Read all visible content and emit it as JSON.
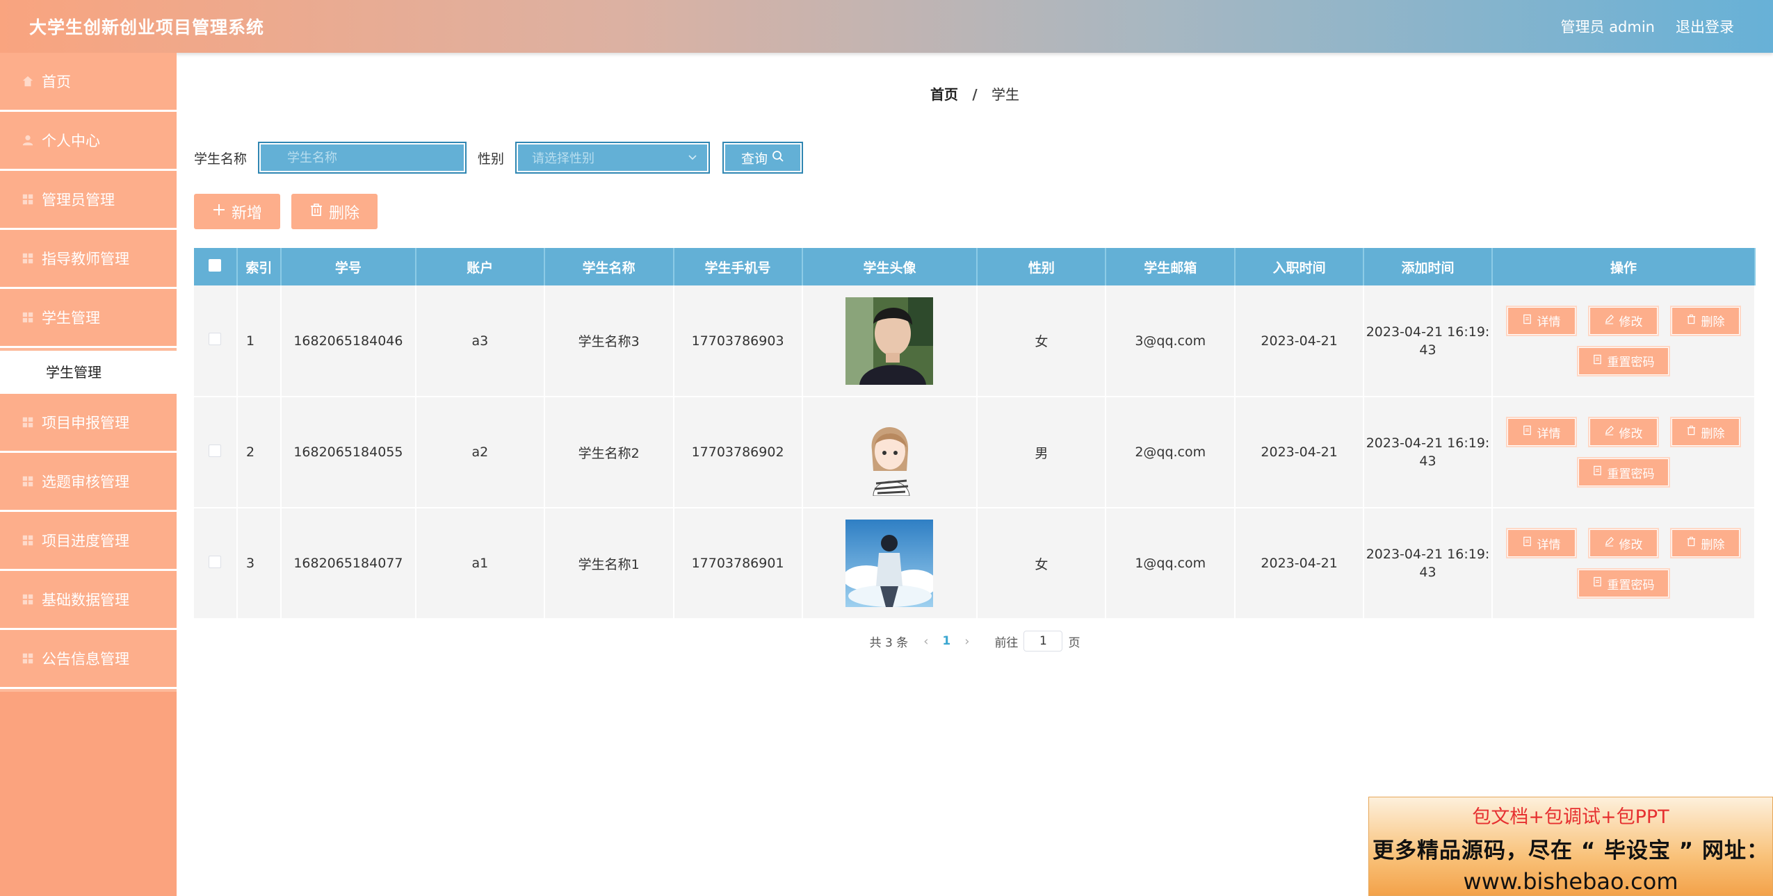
{
  "header": {
    "app_title": "大学生创新创业项目管理系统",
    "user": "管理员 admin",
    "logout": "退出登录"
  },
  "sidebar": {
    "items": [
      {
        "label": "首页",
        "icon": "home-icon"
      },
      {
        "label": "个人中心",
        "icon": "user-icon"
      },
      {
        "label": "管理员管理",
        "icon": "grid-icon"
      },
      {
        "label": "指导教师管理",
        "icon": "grid-icon"
      },
      {
        "label": "学生管理",
        "icon": "grid-icon"
      },
      {
        "label": "项目申报管理",
        "icon": "grid-icon"
      },
      {
        "label": "选题审核管理",
        "icon": "grid-icon"
      },
      {
        "label": "项目进度管理",
        "icon": "grid-icon"
      },
      {
        "label": "基础数据管理",
        "icon": "grid-icon"
      },
      {
        "label": "公告信息管理",
        "icon": "grid-icon"
      }
    ],
    "active_sub": "学生管理"
  },
  "breadcrumb": {
    "home": "首页",
    "sep": "/",
    "current": "学生"
  },
  "search": {
    "name_label": "学生名称",
    "name_placeholder": "学生名称",
    "gender_label": "性别",
    "gender_placeholder": "请选择性别",
    "query_label": "查询"
  },
  "actions": {
    "add": "新增",
    "delete": "删除"
  },
  "table": {
    "headers": [
      "索引",
      "学号",
      "账户",
      "学生名称",
      "学生手机号",
      "学生头像",
      "性别",
      "学生邮箱",
      "入职时间",
      "添加时间",
      "操作"
    ],
    "rows": [
      {
        "index": "1",
        "student_no": "1682065184046",
        "account": "a3",
        "name": "学生名称3",
        "phone": "17703786903",
        "avatar": "photo-man",
        "gender": "女",
        "email": "3@qq.com",
        "join_date": "2023-04-21",
        "added_line1": "2023-04-21 16:19:",
        "added_line2": "43"
      },
      {
        "index": "2",
        "student_no": "1682065184055",
        "account": "a2",
        "name": "学生名称2",
        "phone": "17703786902",
        "avatar": "illustration-girl",
        "gender": "男",
        "email": "2@qq.com",
        "join_date": "2023-04-21",
        "added_line1": "2023-04-21 16:19:",
        "added_line2": "43"
      },
      {
        "index": "3",
        "student_no": "1682065184077",
        "account": "a1",
        "name": "学生名称1",
        "phone": "17703786901",
        "avatar": "illustration-boy-sky",
        "gender": "女",
        "email": "1@qq.com",
        "join_date": "2023-04-21",
        "added_line1": "2023-04-21 16:19:",
        "added_line2": "43"
      }
    ],
    "ops": {
      "detail": "详情",
      "edit": "修改",
      "delete": "删除",
      "reset": "重置密码"
    }
  },
  "pagination": {
    "total": "共 3 条",
    "current": "1",
    "goto": "前往",
    "page_value": "1",
    "page_unit": "页"
  },
  "ad": {
    "line1": "包文档+包调试+包PPT",
    "line2": "更多精品源码，尽在 “ 毕设宝 ” 网址：",
    "line3": "www.bishebao.com"
  },
  "colors": {
    "accent_blue": "#63b0d6",
    "accent_orange": "#fdae8b",
    "sidebar": "#fba37e"
  }
}
